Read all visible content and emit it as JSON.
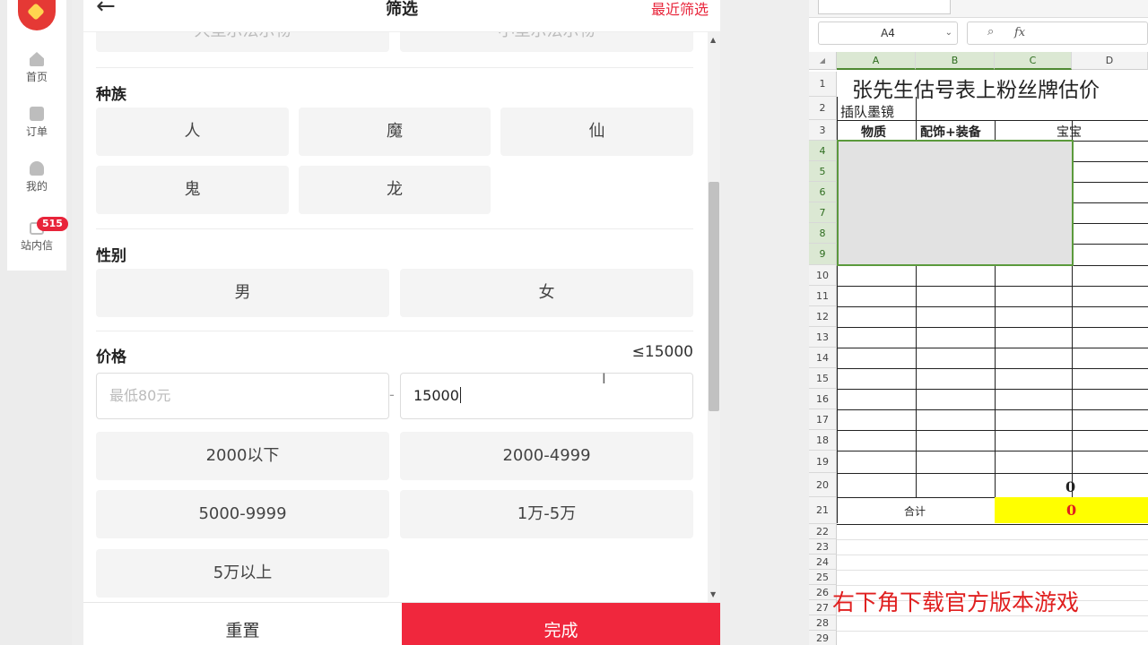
{
  "sidebar": {
    "items": [
      {
        "label": "首页",
        "icon": "home-icon"
      },
      {
        "label": "订单",
        "icon": "order-icon"
      },
      {
        "label": "我的",
        "icon": "user-icon"
      },
      {
        "label": "站内信",
        "icon": "message-icon",
        "badge": "515"
      }
    ]
  },
  "filter": {
    "title": "筛选",
    "recent_label": "最近筛选",
    "top_partial": [
      "大型示法示物",
      "小型示法示物"
    ],
    "race": {
      "title": "种族",
      "options": [
        "人",
        "魔",
        "仙",
        "鬼",
        "龙"
      ]
    },
    "gender": {
      "title": "性别",
      "options": [
        "男",
        "女"
      ]
    },
    "price": {
      "title": "价格",
      "cap": "≤15000",
      "min_placeholder": "最低80元",
      "separator": "-",
      "max_value": "15000",
      "ranges": [
        "2000以下",
        "2000-4999",
        "5000-9999",
        "1万-5万",
        "5万以上"
      ]
    },
    "reset_label": "重置",
    "done_label": "完成"
  },
  "sheet": {
    "name_box": "A4",
    "fx_label": "fx",
    "columns": [
      "A",
      "B",
      "C",
      "D"
    ],
    "rows": [
      "1",
      "2",
      "3",
      "4",
      "5",
      "6",
      "7",
      "8",
      "9",
      "10",
      "11",
      "12",
      "13",
      "14",
      "15",
      "16",
      "17",
      "18",
      "19",
      "20",
      "21",
      "22",
      "23",
      "24",
      "25",
      "26",
      "27",
      "28",
      "29"
    ],
    "title": "张先生估号表上粉丝牌估价",
    "a2": "插队墨镜",
    "headers": [
      "物质",
      "配饰+装备",
      "宝宝"
    ],
    "c20": "0",
    "total_label": "合计",
    "total_value": "0"
  },
  "watermark": "右下角下载官方版本游戏",
  "colors": {
    "accent_red": "#f0273d",
    "selection_green": "#5b9a3c",
    "total_fill": "#ffff00",
    "total_text": "#e01f1f"
  }
}
